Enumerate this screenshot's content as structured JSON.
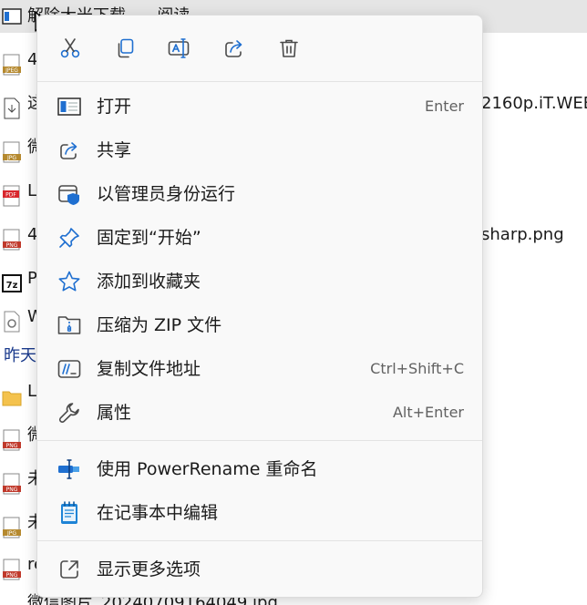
{
  "background": {
    "selected_row_text": "解除大米下载......阅读",
    "rows": [
      {
        "icon": "jpeg-file-icon",
        "icon_label": "JPEG",
        "text": "4"
      },
      {
        "icon": "download-file-icon",
        "icon_label": "",
        "text": "这",
        "right_text": "2160p.iT.WEB"
      },
      {
        "icon": "jpg-file-icon",
        "icon_label": "JPG",
        "text": "微"
      },
      {
        "icon": "pdf-file-icon",
        "icon_label": "PDF",
        "text": "L"
      },
      {
        "icon": "png-file-icon",
        "icon_label": "PNG",
        "text": "4",
        "right_text": "sharp.png"
      },
      {
        "icon": "7z-file-icon",
        "icon_label": "7z",
        "text": "P"
      },
      {
        "icon": "settings-file-icon",
        "icon_label": "",
        "text": "W"
      }
    ],
    "group_header": "昨天",
    "rows2": [
      {
        "icon": "folder-icon",
        "icon_label": "",
        "text": "L"
      },
      {
        "icon": "png-file-icon",
        "icon_label": "PNG",
        "text": "微"
      },
      {
        "icon": "png-file-icon",
        "icon_label": "PNG",
        "text": "未"
      },
      {
        "icon": "jpg-file-icon",
        "icon_label": "JPG",
        "text": "未"
      },
      {
        "icon": "png-file-icon",
        "icon_label": "PNG",
        "text": "re"
      }
    ],
    "bottom_row_text": "微信图片_20240709164049.jpg"
  },
  "context_menu": {
    "quick_actions": [
      {
        "name": "cut",
        "icon": "scissors-icon"
      },
      {
        "name": "copy",
        "icon": "copy-icon"
      },
      {
        "name": "rename",
        "icon": "rename-icon"
      },
      {
        "name": "share",
        "icon": "share-icon"
      },
      {
        "name": "delete",
        "icon": "trash-icon"
      }
    ],
    "items": [
      {
        "label": "打开",
        "shortcut": "Enter",
        "icon": "open-app-icon"
      },
      {
        "label": "共享",
        "shortcut": "",
        "icon": "share-icon"
      },
      {
        "label": "以管理员身份运行",
        "shortcut": "",
        "icon": "shield-icon"
      },
      {
        "label": "固定到“开始”",
        "shortcut": "",
        "icon": "pin-icon"
      },
      {
        "label": "添加到收藏夹",
        "shortcut": "",
        "icon": "star-icon"
      },
      {
        "label": "压缩为 ZIP 文件",
        "shortcut": "",
        "icon": "zip-icon"
      },
      {
        "label": "复制文件地址",
        "shortcut": "Ctrl+Shift+C",
        "icon": "copy-path-icon"
      },
      {
        "label": "属性",
        "shortcut": "Alt+Enter",
        "icon": "wrench-icon"
      }
    ],
    "extensions": [
      {
        "label": "使用 PowerRename 重命名",
        "icon": "powerrename-icon"
      },
      {
        "label": "在记事本中编辑",
        "icon": "notepad-icon"
      }
    ],
    "more": {
      "label": "显示更多选项",
      "icon": "more-options-icon"
    }
  },
  "colors": {
    "accent": "#1f6fd0",
    "icon_stroke": "#5b5b5b",
    "menu_bg": "#f9f9f9",
    "selected_row": "#e5e5e5"
  }
}
